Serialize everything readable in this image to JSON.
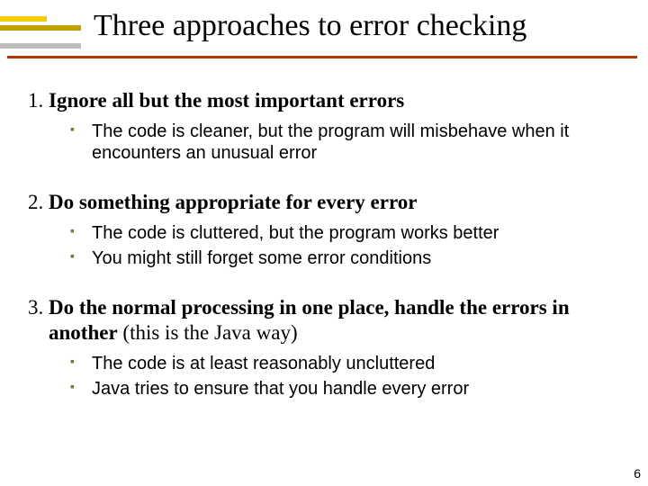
{
  "title": "Three approaches to error checking",
  "items": [
    {
      "head": "Ignore all but the most important errors",
      "paren": "",
      "sub": [
        "The code is cleaner, but the program will misbehave when it encounters an unusual error"
      ]
    },
    {
      "head": "Do something appropriate for every error",
      "paren": "",
      "sub": [
        "The code is cluttered, but the program works better",
        "You might still forget some error conditions"
      ]
    },
    {
      "head": "Do the normal processing in one place, handle the errors in another",
      "paren": " (this is the Java way)",
      "sub": [
        "The code is at least reasonably uncluttered",
        "Java tries to ensure that you handle every error"
      ]
    }
  ],
  "page_number": "6"
}
